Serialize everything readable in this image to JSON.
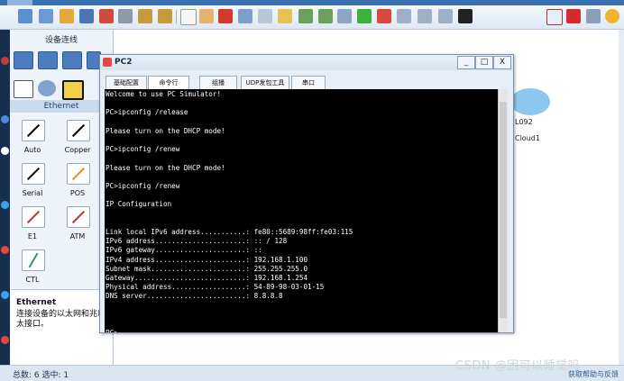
{
  "device_panel": {
    "title": "设备连线",
    "ethernet_header": "Ethernet",
    "cables": [
      {
        "label": "Auto"
      },
      {
        "label": "Copper"
      },
      {
        "label": "Serial"
      },
      {
        "label": "POS"
      },
      {
        "label": "E1"
      },
      {
        "label": "ATM"
      },
      {
        "label": "CTL"
      }
    ],
    "description_title": "Ethernet",
    "description_body": "连接设备的以太网和兆以太接口。"
  },
  "canvas": {
    "cloud_label_1": "L092",
    "cloud_label_2": "Cloud1"
  },
  "window": {
    "title": "PC2",
    "min": "_",
    "max": "□",
    "close": "X",
    "tabs": [
      "基础配置",
      "命令行",
      "组播",
      "UDP发包工具",
      "串口"
    ],
    "active_tab": "命令行"
  },
  "terminal": {
    "lines": [
      "Welcome to use PC Simulator!",
      "",
      "PC>ipconfig /release",
      "",
      "Please turn on the DHCP mode!",
      "",
      "PC>ipconfig /renew",
      "",
      "Please turn on the DHCP mode!",
      "",
      "PC>ipconfig /renew",
      "",
      "IP Configuration",
      "",
      "",
      "Link local IPv6 address...........: fe80::5689:98ff:fe03:115",
      "IPv6 address......................: :: / 128",
      "IPv6 gateway......................: ::",
      "IPv4 address......................: 192.168.1.100",
      "Subnet mask.......................: 255.255.255.0",
      "Gateway...........................: 192.168.1.254",
      "Physical address..................: 54-89-98-03-01-15",
      "DNS server........................: 8.8.8.8",
      "",
      "",
      "",
      "PC>"
    ]
  },
  "status_bar": {
    "text": "总数: 6 选中: 1",
    "right_text": "获取帮助与反馈"
  },
  "watermark": "CSDN @困可以睡觉吗"
}
